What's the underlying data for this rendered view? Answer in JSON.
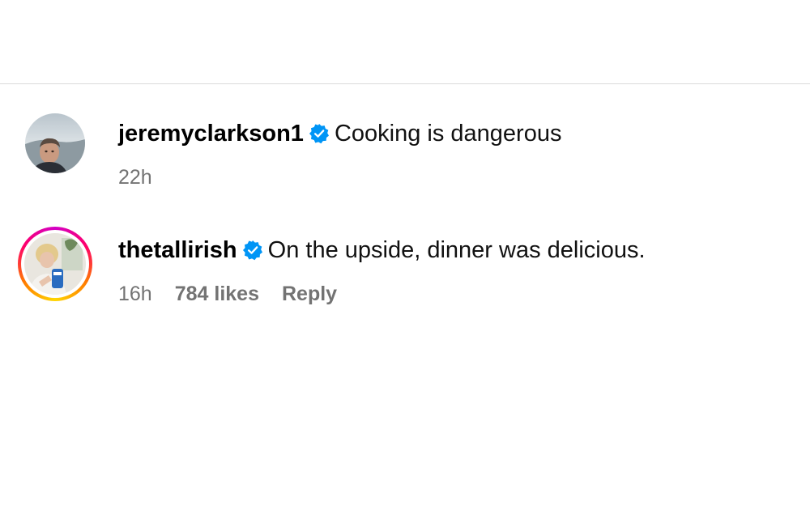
{
  "comments": [
    {
      "username": "jeremyclarkson1",
      "verified": true,
      "text": "Cooking is dangerous",
      "time": "22h",
      "likes": "",
      "reply": ""
    },
    {
      "username": "thetallirish",
      "verified": true,
      "has_story_ring": true,
      "text": "On the upside, dinner was delicious.",
      "time": "16h",
      "likes": "784 likes",
      "reply": "Reply"
    }
  ],
  "colors": {
    "verified_badge": "#0095f6",
    "meta_text": "#737373",
    "divider": "#dbdbdb"
  }
}
